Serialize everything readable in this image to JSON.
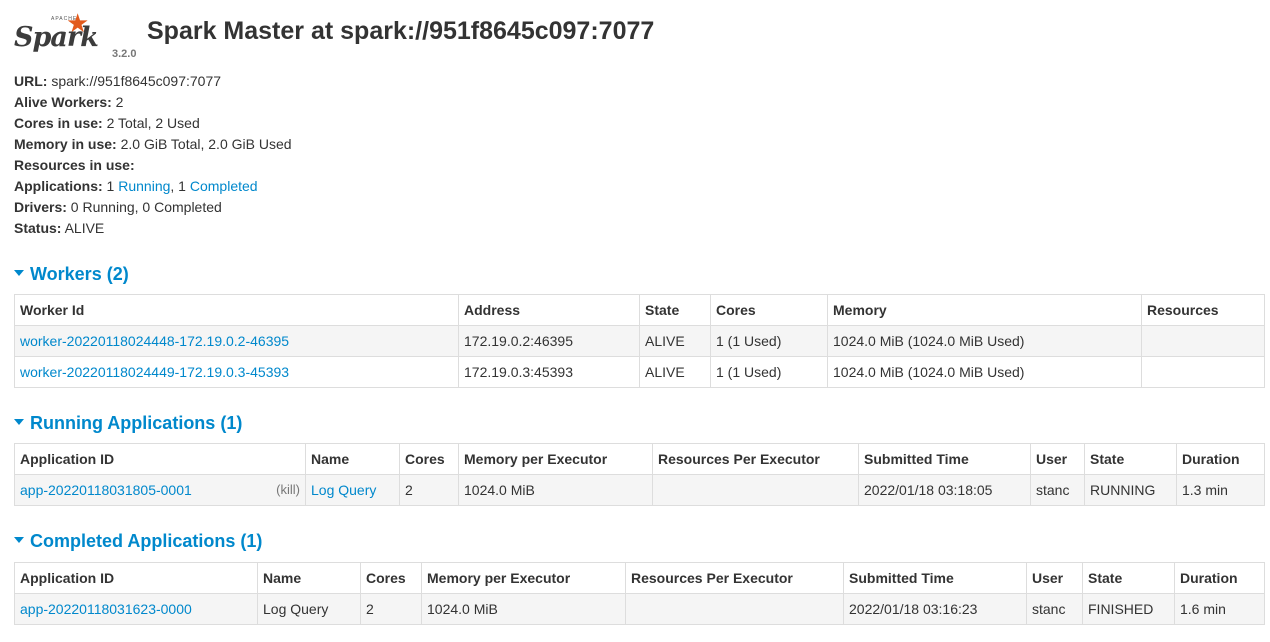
{
  "header": {
    "logo_apache": "APACHE",
    "logo_word": "Spark",
    "version": "3.2.0",
    "title": "Spark Master at spark://951f8645c097:7077"
  },
  "summary": {
    "url_label": "URL:",
    "url_value": " spark://951f8645c097:7077",
    "workers_label": "Alive Workers:",
    "workers_value": " 2",
    "cores_label": "Cores in use:",
    "cores_value": " 2 Total, 2 Used",
    "memory_label": "Memory in use:",
    "memory_value": " 2.0 GiB Total, 2.0 GiB Used",
    "resources_label": "Resources in use:",
    "apps_label": "Applications:",
    "apps_running_count": " 1 ",
    "apps_running_link": "Running",
    "apps_sep": ", 1 ",
    "apps_completed_link": "Completed",
    "drivers_label": "Drivers:",
    "drivers_value": " 0 Running, 0 Completed",
    "status_label": "Status:",
    "status_value": " ALIVE"
  },
  "workers": {
    "heading": "Workers (2)",
    "columns": [
      "Worker Id",
      "Address",
      "State",
      "Cores",
      "Memory",
      "Resources"
    ],
    "rows": [
      [
        "worker-20220118024448-172.19.0.2-46395",
        "172.19.0.2:46395",
        "ALIVE",
        "1 (1 Used)",
        "1024.0 MiB (1024.0 MiB Used)",
        ""
      ],
      [
        "worker-20220118024449-172.19.0.3-45393",
        "172.19.0.3:45393",
        "ALIVE",
        "1 (1 Used)",
        "1024.0 MiB (1024.0 MiB Used)",
        ""
      ]
    ]
  },
  "running": {
    "heading": "Running Applications (1)",
    "columns": [
      "Application ID",
      "Name",
      "Cores",
      "Memory per Executor",
      "Resources Per Executor",
      "Submitted Time",
      "User",
      "State",
      "Duration"
    ],
    "kill_label": "(kill)",
    "rows": [
      [
        "app-20220118031805-0001",
        "Log Query",
        "2",
        "1024.0 MiB",
        "",
        "2022/01/18 03:18:05",
        "stanc",
        "RUNNING",
        "1.3 min"
      ]
    ]
  },
  "completed": {
    "heading": "Completed Applications (1)",
    "columns": [
      "Application ID",
      "Name",
      "Cores",
      "Memory per Executor",
      "Resources Per Executor",
      "Submitted Time",
      "User",
      "State",
      "Duration"
    ],
    "rows": [
      [
        "app-20220118031623-0000",
        "Log Query",
        "2",
        "1024.0 MiB",
        "",
        "2022/01/18 03:16:23",
        "stanc",
        "FINISHED",
        "1.6 min"
      ]
    ]
  },
  "colors": {
    "link": "#0088cc",
    "logo_star": "#e25a1c",
    "row_stripe": "#f5f5f5"
  },
  "icons": {
    "logo_star": "★"
  }
}
